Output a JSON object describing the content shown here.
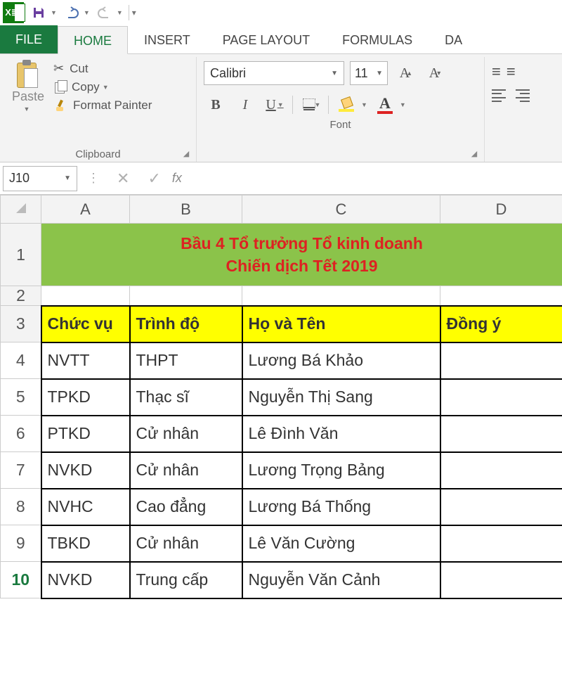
{
  "qat": {
    "app": "X≣"
  },
  "tabs": {
    "file": "FILE",
    "home": "HOME",
    "insert": "INSERT",
    "page_layout": "PAGE LAYOUT",
    "formulas": "FORMULAS",
    "data": "DA"
  },
  "clipboard": {
    "paste": "Paste",
    "cut": "Cut",
    "copy": "Copy",
    "format_painter": "Format Painter",
    "group_label": "Clipboard"
  },
  "font": {
    "name": "Calibri",
    "size": "11",
    "bold": "B",
    "italic": "I",
    "underline": "U",
    "fontcolor_letter": "A",
    "grow": "A",
    "shrink": "A",
    "group_label": "Font"
  },
  "namebox": {
    "ref": "J10"
  },
  "fx": {
    "label": "fx"
  },
  "sheet": {
    "columns": [
      "A",
      "B",
      "C",
      "D"
    ],
    "title_line1": "Bầu 4 Tổ trưởng Tổ kinh doanh",
    "title_line2": "Chiến dịch Tết 2019",
    "headers": {
      "a": "Chức vụ",
      "b": "Trình độ",
      "c": "Họ và Tên",
      "d": "Đồng ý"
    },
    "rows": [
      {
        "num": "1"
      },
      {
        "num": "2"
      },
      {
        "num": "3"
      },
      {
        "num": "4",
        "a": "NVTT",
        "b": "THPT",
        "c": "Lương Bá Khảo",
        "d": ""
      },
      {
        "num": "5",
        "a": "TPKD",
        "b": "Thạc sĩ",
        "c": "Nguyễn Thị Sang",
        "d": ""
      },
      {
        "num": "6",
        "a": "PTKD",
        "b": "Cử nhân",
        "c": "Lê Đình Văn",
        "d": ""
      },
      {
        "num": "7",
        "a": "NVKD",
        "b": "Cử nhân",
        "c": "Lương Trọng Bảng",
        "d": ""
      },
      {
        "num": "8",
        "a": "NVHC",
        "b": "Cao đẳng",
        "c": "Lương Bá Thống",
        "d": ""
      },
      {
        "num": "9",
        "a": "TBKD",
        "b": "Cử nhân",
        "c": "Lê Văn Cường",
        "d": ""
      },
      {
        "num": "10",
        "a": "NVKD",
        "b": "Trung cấp",
        "c": "Nguyễn Văn Cảnh",
        "d": ""
      }
    ]
  }
}
